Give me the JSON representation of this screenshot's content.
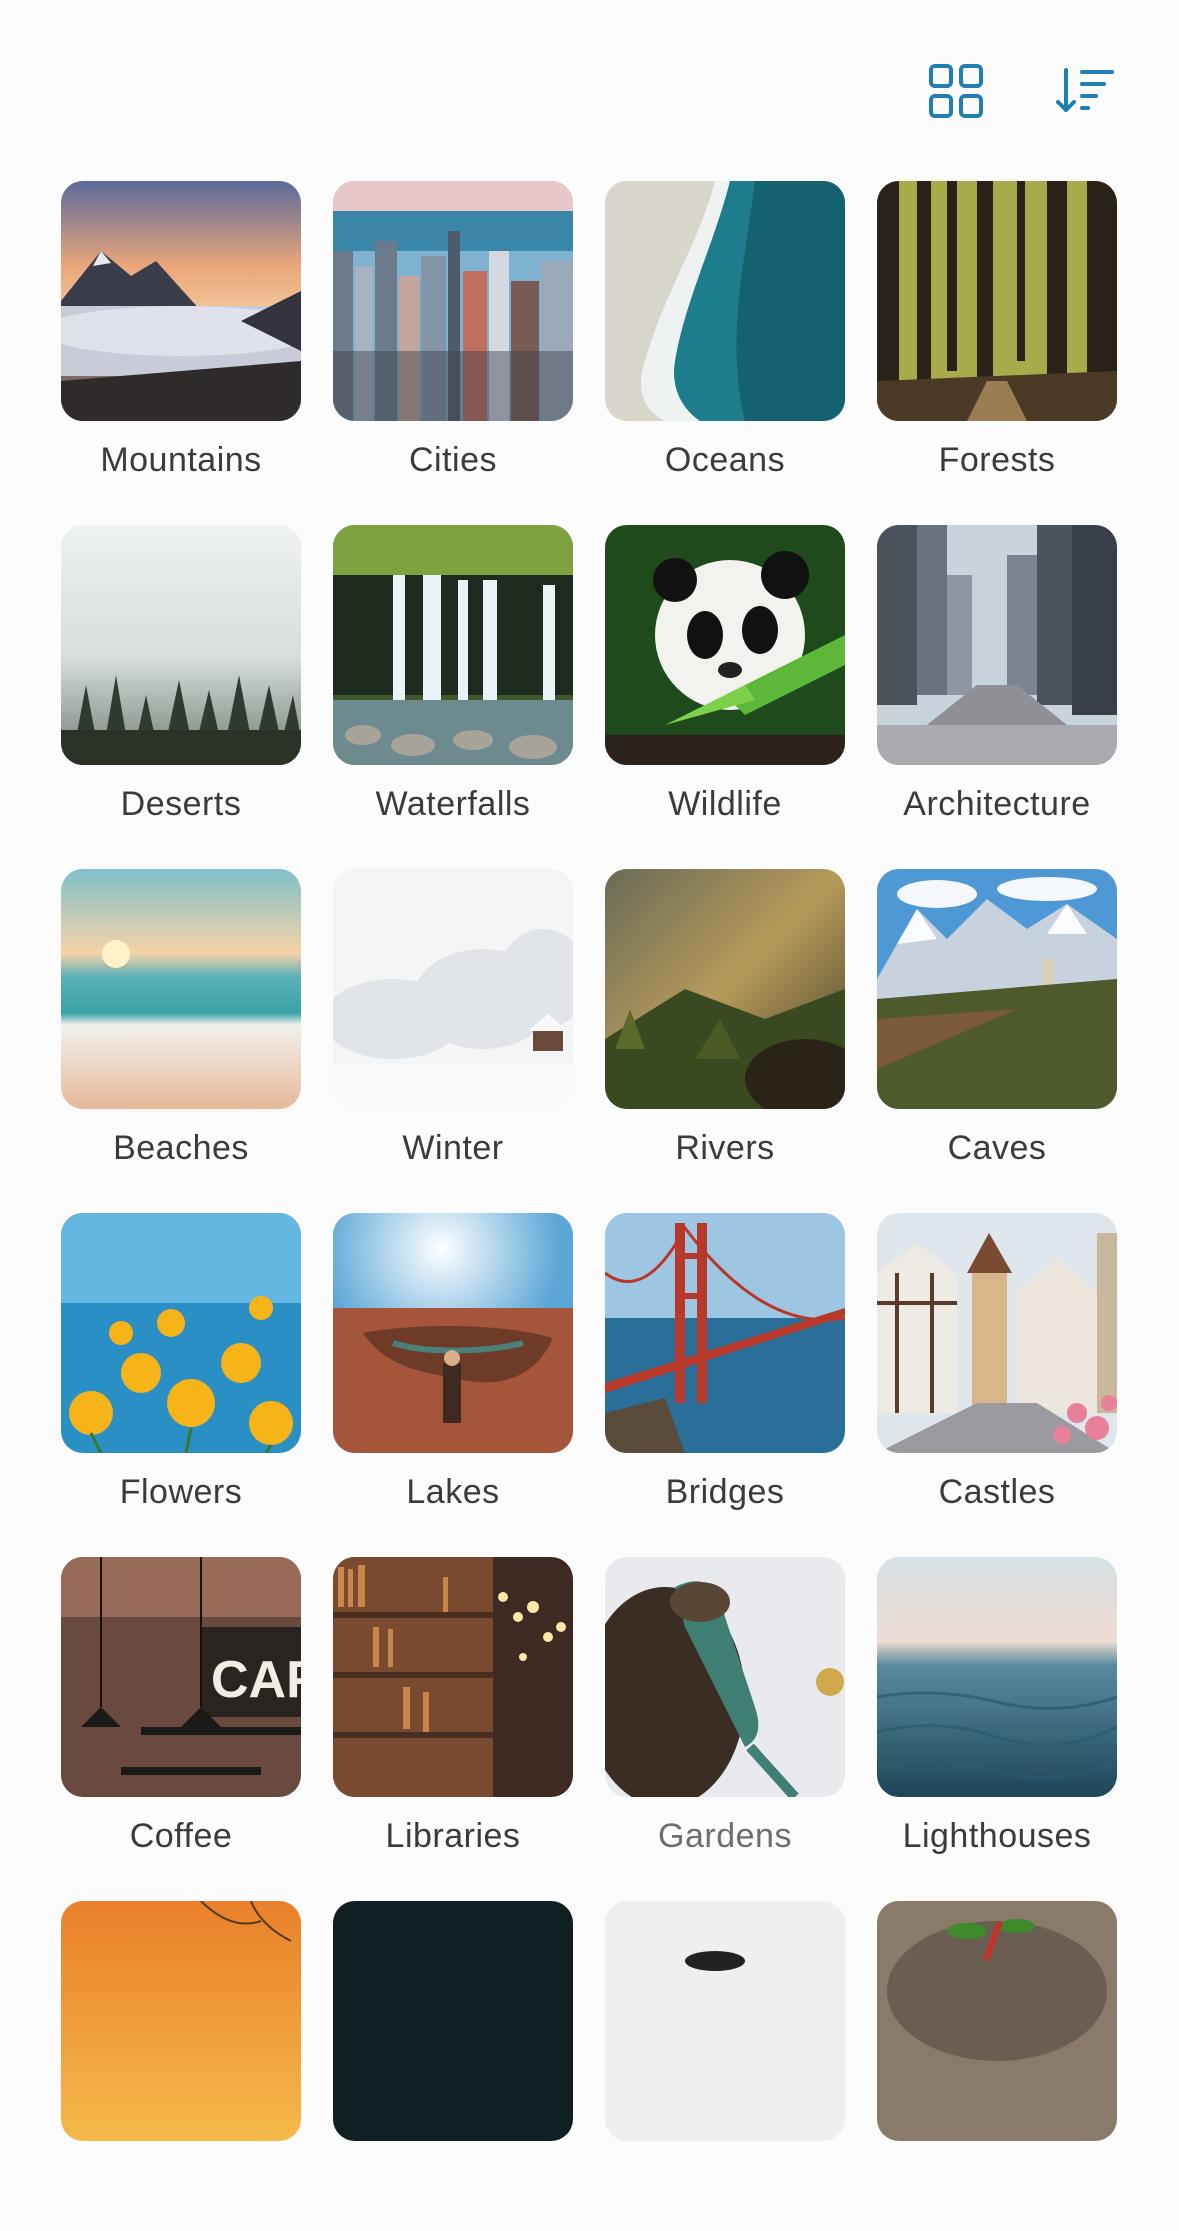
{
  "toolbar": {
    "grid_icon": "grid-view-icon",
    "sort_icon": "sort-descending-icon",
    "accent": "#1f7fb3"
  },
  "categories": [
    {
      "label": "Mountains"
    },
    {
      "label": "Cities"
    },
    {
      "label": "Oceans"
    },
    {
      "label": "Forests"
    },
    {
      "label": "Deserts"
    },
    {
      "label": "Waterfalls"
    },
    {
      "label": "Wildlife"
    },
    {
      "label": "Architecture"
    },
    {
      "label": "Beaches"
    },
    {
      "label": "Winter"
    },
    {
      "label": "Rivers"
    },
    {
      "label": "Caves"
    },
    {
      "label": "Flowers"
    },
    {
      "label": "Lakes"
    },
    {
      "label": "Bridges"
    },
    {
      "label": "Castles"
    },
    {
      "label": "Coffee"
    },
    {
      "label": "Libraries"
    },
    {
      "label": "Gardens"
    },
    {
      "label": "Lighthouses"
    }
  ]
}
